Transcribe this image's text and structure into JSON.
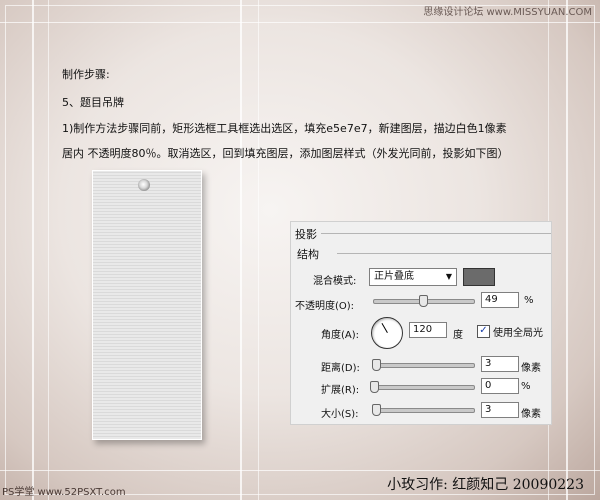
{
  "watermark_top": "思缘设计论坛 www.MISSYUAN.COM",
  "watermark_bottom_left": "PS学堂 www.52PSXT.com",
  "signature": "小玫习作:  红颜知己  20090223",
  "content": {
    "heading": "制作步骤:",
    "step": "5、题目吊牌",
    "line1": "1)制作方法步骤同前，矩形选框工具框选出选区，填充e5e7e7，新建图层，描边白色1像素",
    "line2": "居内  不透明度80％。取消选区，回到填充图层，添加图层样式（外发光同前，投影如下图）"
  },
  "panel": {
    "title": "投影",
    "section": "结构",
    "blend_label": "混合模式:",
    "blend_value": "正片叠底",
    "shadow_color": "#6b6b6b",
    "opacity_label": "不透明度(O):",
    "opacity_value": "49",
    "opacity_unit": "%",
    "opacity_fraction": 0.49,
    "angle_label": "角度(A):",
    "angle_value": "120",
    "angle_unit": "度",
    "global_light_label": "使用全局光",
    "global_light_checked": true,
    "distance_label": "距离(D):",
    "distance_value": "3",
    "distance_unit": "像素",
    "spread_label": "扩展(R):",
    "spread_value": "0",
    "spread_unit": "%",
    "size_label": "大小(S):",
    "size_value": "3",
    "size_unit": "像素"
  }
}
